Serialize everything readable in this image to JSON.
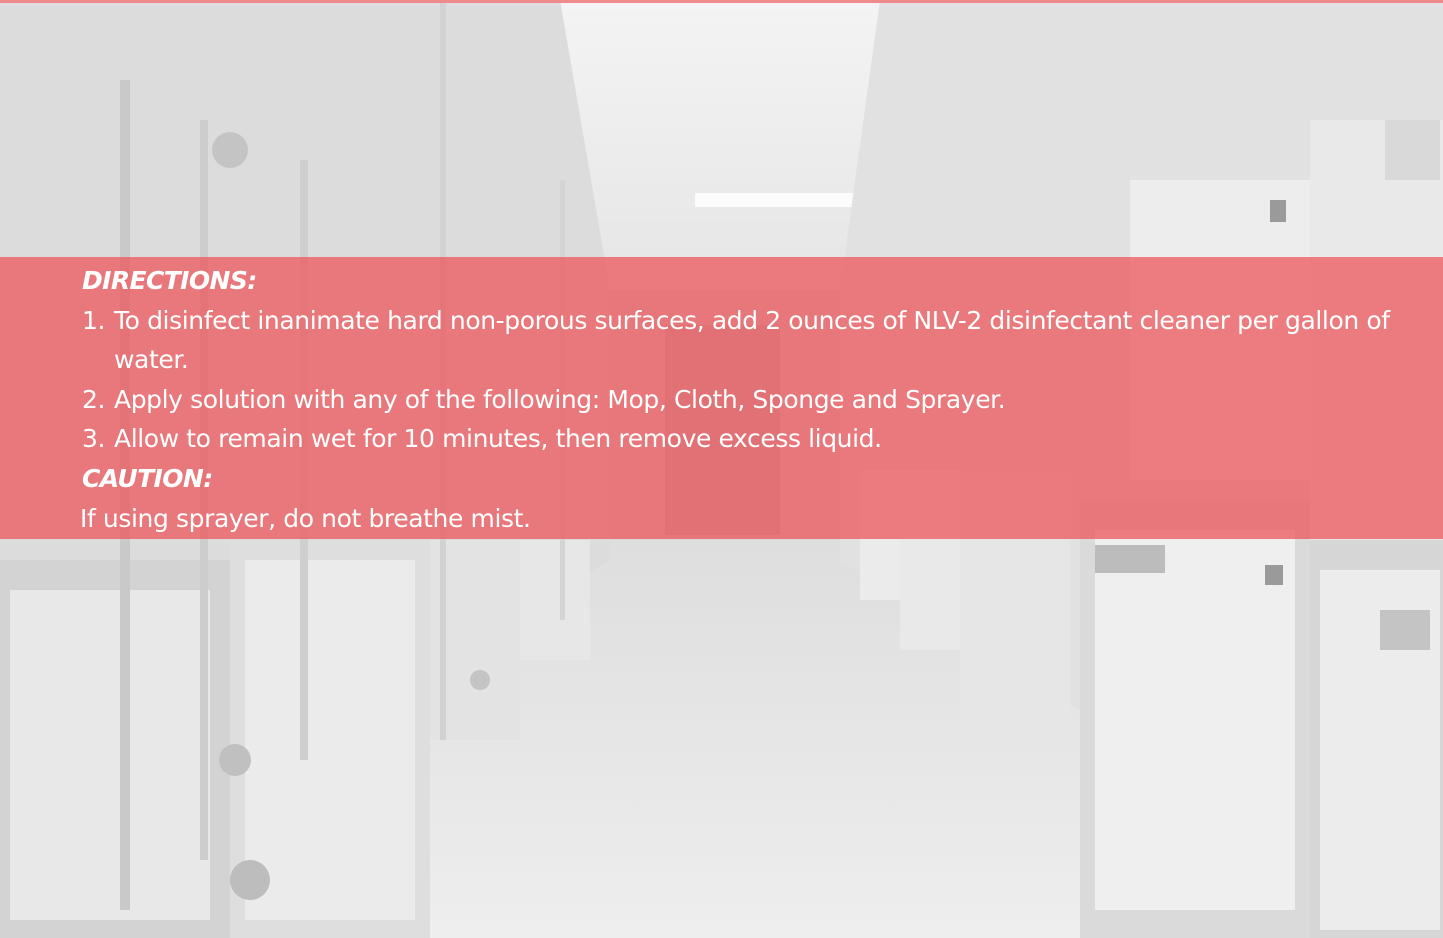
{
  "directions": {
    "heading": "DIRECTIONS:",
    "steps": [
      {
        "number": "1.",
        "text": "To disinfect inanimate hard non-porous surfaces, add 2 ounces of NLV-2 disinfectant cleaner per gallon of water."
      },
      {
        "number": "2.",
        "text": "Apply solution with any of the following: Mop, Cloth, Sponge and Sprayer."
      },
      {
        "number": "3.",
        "text": "Allow to remain wet for 10 minutes, then remove excess liquid."
      }
    ]
  },
  "caution": {
    "heading": "CAUTION:",
    "text": "If using sprayer, do not breathe mist."
  },
  "colors": {
    "band": "#eb585c",
    "text": "#ffffff",
    "photo_tint": "#e9e9e9"
  }
}
